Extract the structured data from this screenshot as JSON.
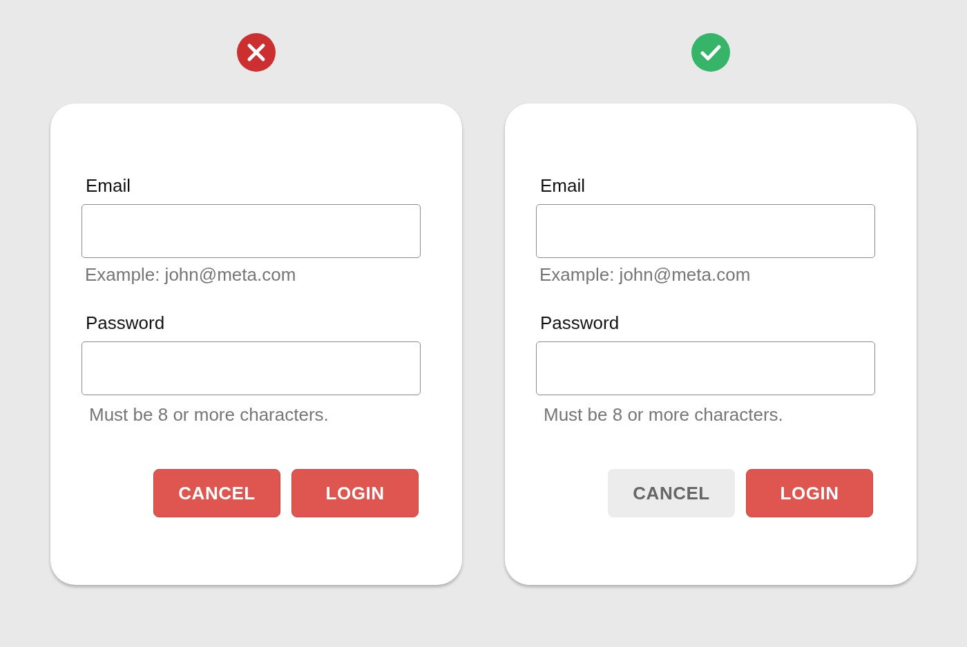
{
  "panels": [
    {
      "approved": false,
      "fields": [
        {
          "label": "Email",
          "hint": "Example: john@meta.com"
        },
        {
          "label": "Password",
          "hint": "Must be 8 or more characters."
        }
      ],
      "buttons": [
        {
          "label": "CANCEL",
          "kind": "primary"
        },
        {
          "label": "LOGIN",
          "kind": "primary"
        }
      ]
    },
    {
      "approved": true,
      "fields": [
        {
          "label": "Email",
          "hint": "Example: john@meta.com"
        },
        {
          "label": "Password",
          "hint": "Must be 8 or more characters."
        }
      ],
      "buttons": [
        {
          "label": "CANCEL",
          "kind": "secondary"
        },
        {
          "label": "LOGIN",
          "kind": "primary"
        }
      ]
    }
  ]
}
